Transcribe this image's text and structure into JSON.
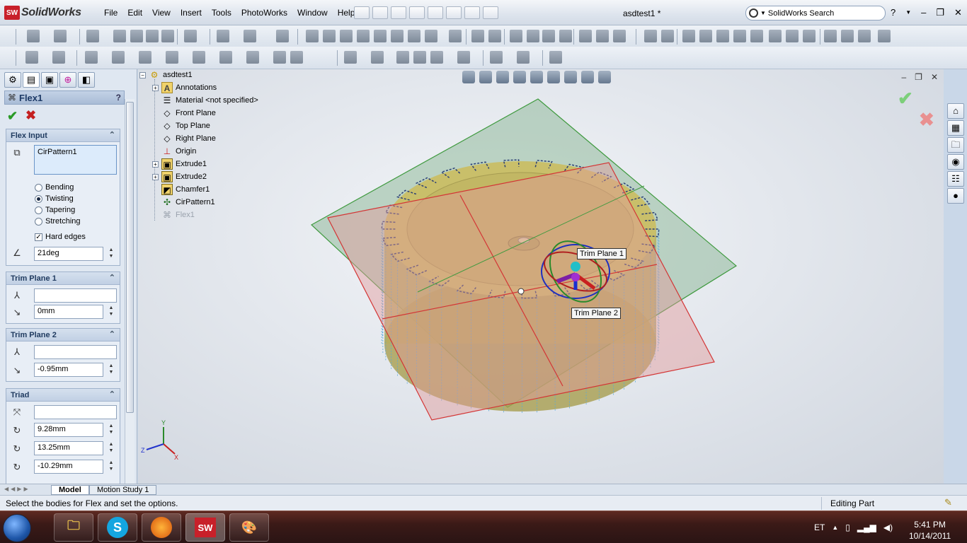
{
  "app": {
    "logo_text": "SolidWorks",
    "document_title": "asdtest1 *",
    "menu": [
      "File",
      "Edit",
      "View",
      "Insert",
      "Tools",
      "PhotoWorks",
      "Window",
      "Help"
    ],
    "search_placeholder": "SolidWorks Search"
  },
  "property_manager": {
    "title": "Flex1",
    "help_label": "?",
    "flex_input": {
      "header": "Flex Input",
      "selected_body": "CirPattern1",
      "modes": [
        "Bending",
        "Twisting",
        "Tapering",
        "Stretching"
      ],
      "selected_mode": "Twisting",
      "hard_edges_label": "Hard edges",
      "hard_edges_checked": true,
      "angle_value": "21deg"
    },
    "trim_plane_1": {
      "header": "Trim Plane 1",
      "entity": "",
      "offset": "0mm"
    },
    "trim_plane_2": {
      "header": "Trim Plane 2",
      "entity": "",
      "offset": "-0.95mm"
    },
    "triad": {
      "header": "Triad",
      "entity": "",
      "x": "9.28mm",
      "y": "13.25mm",
      "z": "-10.29mm"
    }
  },
  "feature_tree": {
    "root": "asdtest1",
    "items": [
      {
        "label": "Annotations",
        "expandable": true,
        "icon": "annotations-icon"
      },
      {
        "label": "Material <not specified>",
        "expandable": false,
        "icon": "material-icon"
      },
      {
        "label": "Front Plane",
        "expandable": false,
        "icon": "plane-icon"
      },
      {
        "label": "Top Plane",
        "expandable": false,
        "icon": "plane-icon"
      },
      {
        "label": "Right Plane",
        "expandable": false,
        "icon": "plane-icon"
      },
      {
        "label": "Origin",
        "expandable": false,
        "icon": "origin-icon"
      },
      {
        "label": "Extrude1",
        "expandable": true,
        "icon": "extrude-icon"
      },
      {
        "label": "Extrude2",
        "expandable": true,
        "icon": "extrude-icon"
      },
      {
        "label": "Chamfer1",
        "expandable": false,
        "icon": "chamfer-icon"
      },
      {
        "label": "CirPattern1",
        "expandable": false,
        "icon": "pattern-icon"
      },
      {
        "label": "Flex1",
        "expandable": false,
        "icon": "flex-icon",
        "dimmed": true
      }
    ]
  },
  "graphics": {
    "callouts": [
      "Trim Plane 1",
      "Trim Plane 2"
    ],
    "axis_labels": [
      "Y",
      "Z",
      "X"
    ]
  },
  "bottom_tabs": [
    "Model",
    "Motion Study 1"
  ],
  "status": {
    "message": "Select the bodies for Flex and set the options.",
    "mode": "Editing Part"
  },
  "taskbar": {
    "language": "ET",
    "time": "5:41 PM",
    "date": "10/14/2011"
  },
  "colors": {
    "accent": "#c8202a",
    "gear": "#b6ad5a",
    "trim_plane_1": "#7fb08a",
    "trim_plane_2": "#e39a9a"
  }
}
